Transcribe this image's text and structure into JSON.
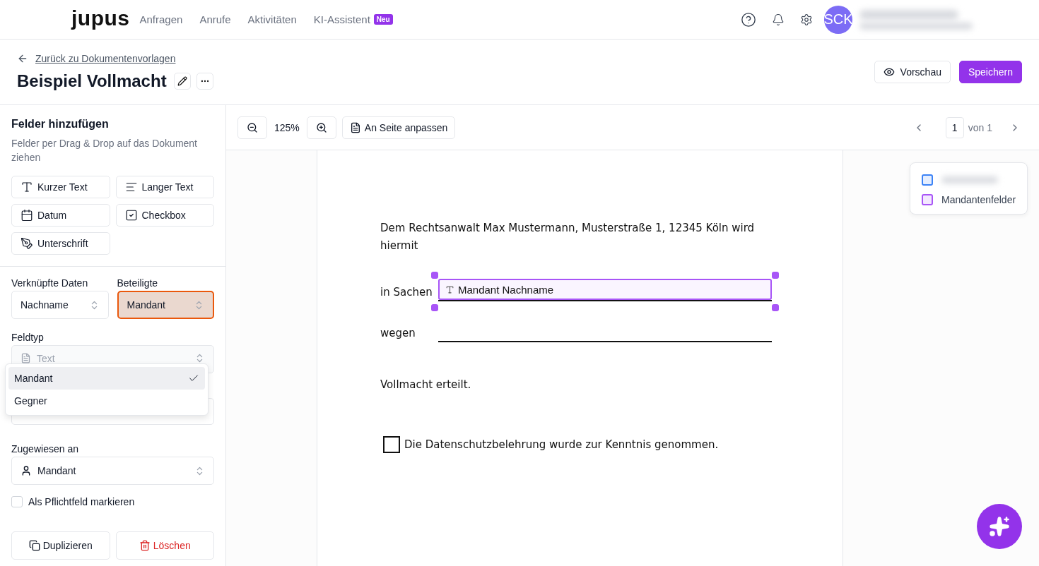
{
  "nav": {
    "logo": "jupus",
    "items": [
      {
        "label": "Anfragen"
      },
      {
        "label": "Anrufe"
      },
      {
        "label": "Aktivitäten"
      },
      {
        "label": "KI-Assistent",
        "badge": "Neu"
      }
    ],
    "avatar": "SCK"
  },
  "header": {
    "back_link": "Zurück zu Dokumentenvorlagen",
    "title": "Beispiel Vollmacht",
    "buttons": [
      {
        "label": "Vorschau",
        "kind": "secondary"
      },
      {
        "label": "Speichern",
        "kind": "primary"
      }
    ]
  },
  "sidebar": {
    "title": "Felder hinzufügen",
    "hint": "Felder per Drag & Drop auf das Dokument ziehen",
    "field_types": [
      {
        "label": "Kurzer Text",
        "kind": "short"
      },
      {
        "label": "Langer Text",
        "kind": "long"
      },
      {
        "label": "Datum",
        "kind": "date"
      },
      {
        "label": "Checkbox",
        "kind": "checkbox"
      },
      {
        "label": "Unterschrift",
        "kind": "signature"
      }
    ],
    "linked_data": {
      "label": "Verknüpfte Daten",
      "value": "Nachname"
    },
    "participants": {
      "label": "Beteiligte",
      "value": "Mandant",
      "focused": true
    },
    "field_type": {
      "label": "Feldtyp",
      "value": "Text",
      "disabled": true
    },
    "dropdown": {
      "options": [
        {
          "label": "Mandant",
          "selected": true
        },
        {
          "label": "Gegner",
          "selected": false
        }
      ]
    },
    "assigned_to": {
      "label": "Zugewiesen an",
      "value": "Mandant"
    },
    "required": {
      "label": "Als Pflichtfeld markieren",
      "checked": false
    },
    "actions": [
      {
        "label": "Duplizieren",
        "kind": "duplicate"
      },
      {
        "label": "Löschen",
        "kind": "delete"
      }
    ]
  },
  "toolbar": {
    "zoom": "125%",
    "fit": "An Seite anpassen",
    "page": "1",
    "page_total": "von 1"
  },
  "document": {
    "intro": "Dem Rechtsanwalt Max Mustermann, Musterstraße 1, 12345 Köln wird hiermit",
    "lines": [
      {
        "label": "in Sachen",
        "field": "Mandant Nachname",
        "selected": true
      },
      {
        "label": "wegen"
      }
    ],
    "closing": "Vollmacht erteilt.",
    "checkbox": {
      "label": "Die Datenschutzbelehrung wurde zur Kenntnis genommen.",
      "checked": false
    }
  },
  "legend": {
    "items": [
      {
        "color": "#3b82f6"
      },
      {
        "label": "Mandantenfelder",
        "color": "#a855f7"
      }
    ]
  }
}
